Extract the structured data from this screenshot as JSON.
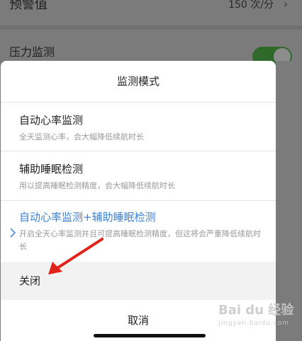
{
  "background": {
    "row1": {
      "label": "预警值",
      "value": "150 次/分",
      "chevron": "›"
    },
    "row2": {
      "label": "压力监测"
    }
  },
  "sheet": {
    "title": "监测模式",
    "options": [
      {
        "title": "自动心率监测",
        "desc": "全天监测心率，会大幅降低续航时长"
      },
      {
        "title": "辅助睡眠检测",
        "desc": "用以提高睡眠检测精度，会大幅降低续航时长"
      },
      {
        "title": "自动心率监测+辅助睡眠检测",
        "desc": "开启全天心率监测并且可提高睡眠检测精度，但这将会严重降低续航时长"
      }
    ],
    "selected_index": 2,
    "close_label": "关闭",
    "cancel_label": "取消"
  },
  "watermark": {
    "text": "Bai du 经验",
    "sub": "jingyan.baidu.com"
  },
  "colors": {
    "accent": "#3b82d6",
    "annotation_arrow": "#e2231a",
    "toggle_on": "#2f6a2a"
  }
}
